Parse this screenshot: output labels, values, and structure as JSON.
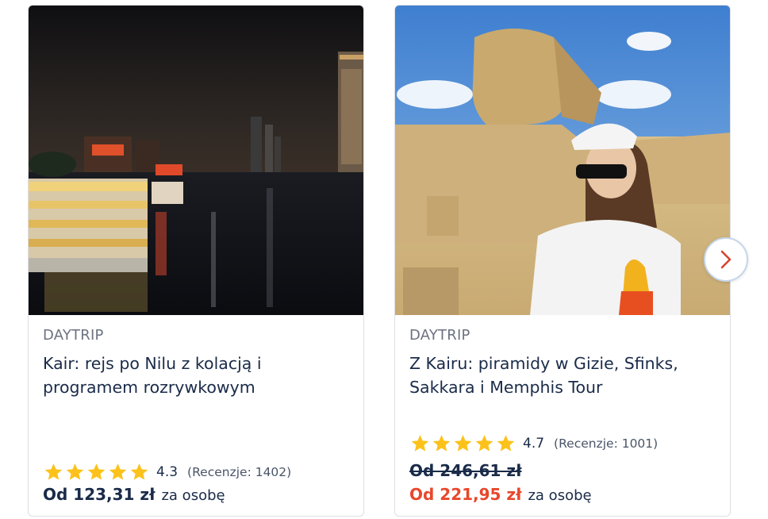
{
  "cards": [
    {
      "image_alt": "Night view of Nile with illuminated cruise boat and Cairo towers",
      "category": "DAYTRIP",
      "title_line1": "Kair: rejs po Nilu z kolacją i",
      "title_line2": "programem rozrywkowym",
      "rating": "4.3",
      "stars": 5,
      "reviews": "(Recenzje: 1402)",
      "price": "Od 123,31 zł",
      "per": "za osobę"
    },
    {
      "image_alt": "Woman in white cap and sunglasses in front of the Great Sphinx",
      "category": "DAYTRIP",
      "title_line1": "Z Kairu: piramidy w Gizie, Sfinks,",
      "title_line2": "Sakkara i Memphis Tour",
      "rating": "4.7",
      "stars": 5,
      "reviews": "(Recenzje: 1001)",
      "old_price": "Od 246,61 zł",
      "price": "Od 221,95 zł",
      "per": "za osobę"
    }
  ],
  "carousel": {
    "next_icon": "chevron-right-icon"
  },
  "colors": {
    "title": "#1a2b49",
    "sale": "#e8472c",
    "star": "#fcc21b",
    "chevron": "#d9432f"
  }
}
